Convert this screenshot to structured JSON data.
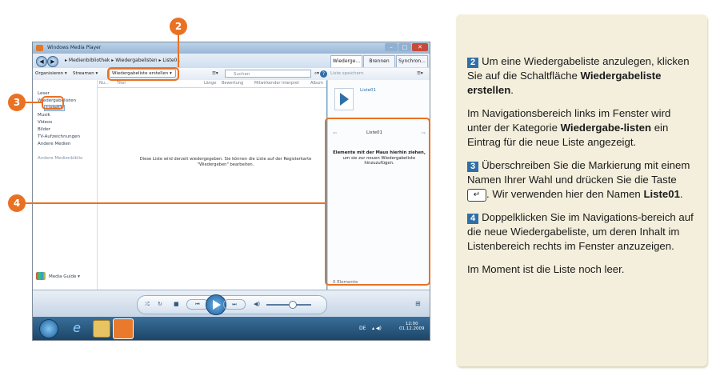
{
  "window": {
    "title": "Windows Media Player",
    "breadcrumb": [
      "Medienbibliothek",
      "Wiedergabelisten",
      "Liste01"
    ],
    "tabs": [
      "Wiederge...",
      "Brennen",
      "Synchron..."
    ]
  },
  "toolbar": {
    "organize": "Organisieren ▾",
    "stream": "Streamen ▾",
    "create": "Wiedergabeliste erstellen",
    "search_placeholder": "Suchen",
    "save_list": "Liste speichern"
  },
  "sidebar": {
    "items": [
      "Leser",
      "Wiedergabelisten",
      "Liste01",
      "Musik",
      "Videos",
      "Bilder",
      "TV-Aufzeichnungen",
      "Andere Medien",
      "Andere Medienbiblio"
    ],
    "media_guide": "Media Guide ▾"
  },
  "main": {
    "columns": [
      "Nu...",
      "Titel",
      "Länge",
      "Bewertung",
      "Mitwirkender Interpret",
      "Album"
    ],
    "empty_line1": "Diese Liste wird derzeit wiedergegeben. Sie können die Liste auf der Registerkarte",
    "empty_line2": "\"Wiedergeben\" bearbeiten."
  },
  "rpane": {
    "list_name": "Liste01",
    "panel_title": "Liste01",
    "drag_title": "Elemente mit der Maus hierhin ziehen,",
    "drag_sub": "um sie zur neuen Wiedergabeliste hinzuzufügen.",
    "count": "0 Elemente"
  },
  "taskbar": {
    "lang": "DE",
    "time": "12:00",
    "date": "01.12.2009"
  },
  "callouts": [
    "2",
    "3",
    "4"
  ],
  "note": {
    "s2_num": "2",
    "s2_a": "Um eine Wiedergabeliste anzulegen, klicken Sie auf die Schaltfläche",
    "s2_b": "Wiedergabeliste erstellen",
    "s2_c": ".",
    "p2_a": "Im Navigationsbereich links im Fenster wird unter der Kategorie",
    "p2_b": "Wiedergabe-listen",
    "p2_c": "ein Eintrag für die neue Liste angezeigt.",
    "s3_num": "3",
    "s3_a": "Überschreiben Sie die Markierung mit einem Namen Ihrer Wahl und drücken Sie die Taste",
    "s3_key": "↵",
    "s3_b": ". Wir verwenden hier den Namen",
    "s3_c": "Liste01",
    "s3_d": ".",
    "s4_num": "4",
    "s4_a": "Doppelklicken Sie im Navigations-bereich auf die neue Wiedergabeliste, um deren Inhalt im Listenbereich rechts im Fenster anzuzeigen.",
    "p5": "Im Moment ist die Liste noch leer."
  },
  "colors": {
    "accent": "#e97123",
    "step_badge": "#2f6fa8",
    "note_bg": "#f4efdc"
  }
}
